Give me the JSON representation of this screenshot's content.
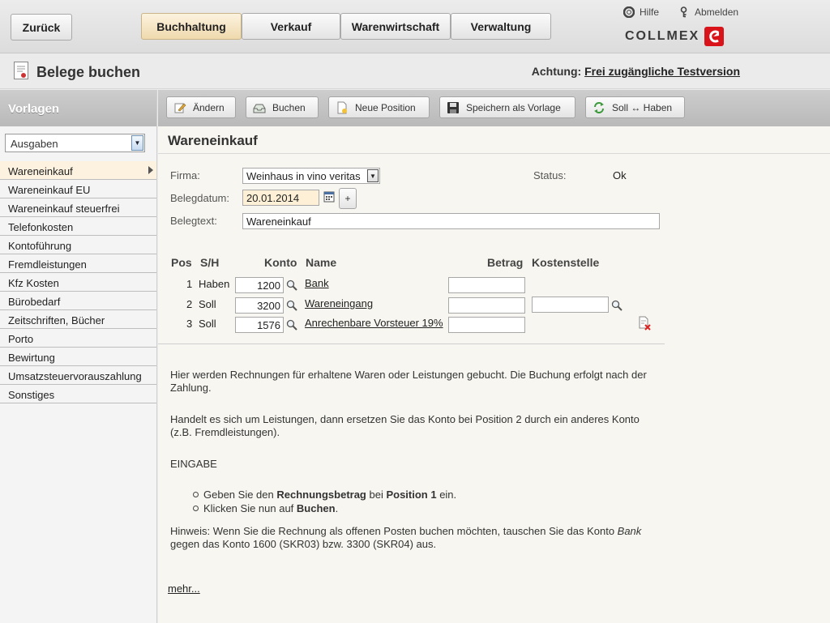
{
  "top": {
    "back_label": "Zurück",
    "tabs": [
      {
        "label": "Buchhaltung"
      },
      {
        "label": "Verkauf"
      },
      {
        "label": "Warenwirtschaft"
      },
      {
        "label": "Verwaltung"
      }
    ],
    "help_label": "Hilfe",
    "logout_label": "Abmelden",
    "logo_text": "COLLMEX"
  },
  "header": {
    "title": "Belege buchen",
    "notice_prefix": "Achtung:",
    "notice_link": "Frei zugängliche Testversion"
  },
  "sidebar": {
    "heading": "Vorlagen",
    "select_value": "Ausgaben",
    "items": [
      {
        "label": "Wareneinkauf"
      },
      {
        "label": "Wareneinkauf EU"
      },
      {
        "label": "Wareneinkauf steuerfrei"
      },
      {
        "label": "Telefonkosten"
      },
      {
        "label": "Kontoführung"
      },
      {
        "label": "Fremdleistungen"
      },
      {
        "label": "Kfz Kosten"
      },
      {
        "label": "Bürobedarf"
      },
      {
        "label": "Zeitschriften, Bücher"
      },
      {
        "label": "Porto"
      },
      {
        "label": "Bewirtung"
      },
      {
        "label": "Umsatzsteuervorauszahlung"
      },
      {
        "label": "Sonstiges"
      }
    ]
  },
  "toolbar": {
    "aendern": "Ändern",
    "buchen": "Buchen",
    "neue_position": "Neue Position",
    "speichern_vorlage": "Speichern als Vorlage",
    "soll_haben": "Soll ↔ Haben"
  },
  "form": {
    "heading": "Wareneinkauf",
    "firma_label": "Firma:",
    "firma_value": "Weinhaus in vino veritas",
    "status_label": "Status:",
    "status_value": "Ok",
    "belegdatum_label": "Belegdatum:",
    "belegdatum_value": "20.01.2014",
    "plus_label": "+",
    "belegtext_label": "Belegtext:",
    "belegtext_value": "Wareneinkauf"
  },
  "positions": {
    "headers": {
      "pos": "Pos",
      "sh": "S/H",
      "konto": "Konto",
      "name": "Name",
      "betrag": "Betrag",
      "kostenstelle": "Kostenstelle"
    },
    "rows": [
      {
        "pos": "1",
        "sh": "Haben",
        "konto": "1200",
        "name": "Bank",
        "betrag": "",
        "kostenstelle": ""
      },
      {
        "pos": "2",
        "sh": "Soll",
        "konto": "3200",
        "name": "Wareneingang",
        "betrag": "",
        "kostenstelle": ""
      },
      {
        "pos": "3",
        "sh": "Soll",
        "konto": "1576",
        "name": "Anrechenbare Vorsteuer 19%",
        "betrag": "",
        "kostenstelle": ""
      }
    ]
  },
  "help": {
    "p1": "Hier werden Rechnungen für erhaltene Waren oder Leistungen gebucht. Die Buchung erfolgt nach der Zahlung.",
    "p2": "Handelt es sich um Leistungen, dann ersetzen Sie das Konto bei Position 2 durch ein anderes Konto (z.B. Fremdleistungen).",
    "eingabe": "EINGABE",
    "b1_pre": "Geben Sie den ",
    "b1_bold1": "Rechnungsbetrag",
    "b1_mid": " bei ",
    "b1_bold2": "Position 1",
    "b1_post": " ein.",
    "b2_pre": "Klicken Sie nun auf ",
    "b2_bold": "Buchen",
    "b2_post": ".",
    "hint_pre": "Hinweis: Wenn Sie die Rechnung als offenen Posten buchen möchten, tauschen Sie das Konto ",
    "hint_em": "Bank",
    "hint_post": " gegen das Konto 1600 (SKR03) bzw. 3300 (SKR04) aus.",
    "more": "mehr..."
  }
}
